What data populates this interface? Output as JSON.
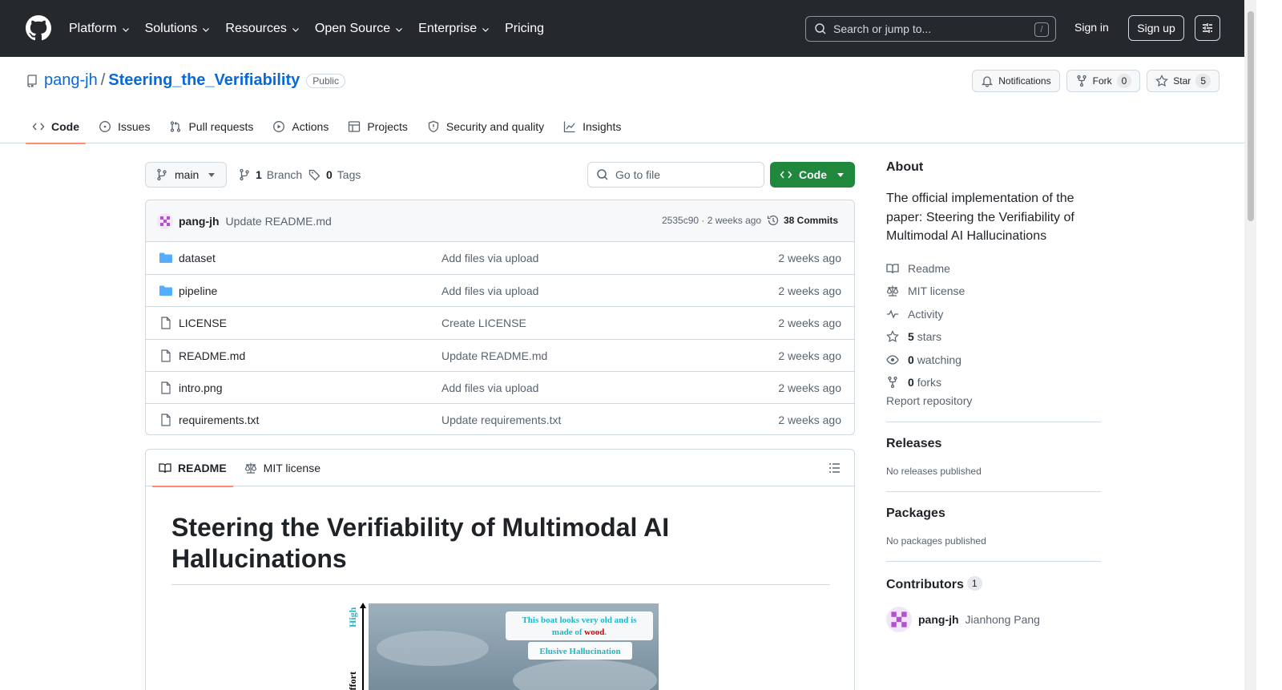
{
  "header": {
    "nav": [
      "Platform",
      "Solutions",
      "Resources",
      "Open Source",
      "Enterprise",
      "Pricing"
    ],
    "search_placeholder": "Search or jump to...",
    "search_shortcut": "/",
    "signin": "Sign in",
    "signup": "Sign up"
  },
  "repo": {
    "owner": "pang-jh",
    "separator": "/",
    "name": "Steering_the_Verifiability",
    "visibility": "Public",
    "notifications": "Notifications",
    "fork_label": "Fork",
    "fork_count": "0",
    "star_label": "Star",
    "star_count": "5"
  },
  "tabs": [
    "Code",
    "Issues",
    "Pull requests",
    "Actions",
    "Projects",
    "Security and quality",
    "Insights"
  ],
  "branchbar": {
    "branch": "main",
    "branch_count": "1",
    "branch_label": "Branch",
    "tag_count": "0",
    "tag_label": "Tags",
    "goto_placeholder": "Go to file",
    "code_button": "Code"
  },
  "commit": {
    "author": "pang-jh",
    "message": "Update README.md",
    "sha_time": "2535c90 · 2 weeks ago",
    "commits": "38 Commits"
  },
  "files": [
    {
      "name": "dataset",
      "type": "dir",
      "message": "Add files via upload",
      "time": "2 weeks ago"
    },
    {
      "name": "pipeline",
      "type": "dir",
      "message": "Add files via upload",
      "time": "2 weeks ago"
    },
    {
      "name": "LICENSE",
      "type": "file",
      "message": "Create LICENSE",
      "time": "2 weeks ago"
    },
    {
      "name": "README.md",
      "type": "file",
      "message": "Update README.md",
      "time": "2 weeks ago"
    },
    {
      "name": "intro.png",
      "type": "file",
      "message": "Add files via upload",
      "time": "2 weeks ago"
    },
    {
      "name": "requirements.txt",
      "type": "file",
      "message": "Update requirements.txt",
      "time": "2 weeks ago"
    }
  ],
  "readme": {
    "tab_readme": "README",
    "tab_license": "MIT license",
    "title": "Steering the Verifiability of Multimodal AI Hallucinations",
    "figure": {
      "axis_high": "High",
      "axis_label": "n Effort",
      "bubble_text_1": "This boat looks very old and is",
      "bubble_text_2a": "made of ",
      "bubble_text_2b": "wood",
      "bubble_text_2c": ".",
      "tag": "Elusive Hallucination"
    }
  },
  "about": {
    "heading": "About",
    "description": "The official implementation of the paper: Steering the Verifiability of Multimodal AI Hallucinations",
    "readme": "Readme",
    "license": "MIT license",
    "activity": "Activity",
    "stars_count": "5",
    "stars_label": "stars",
    "watching_count": "0",
    "watching_label": "watching",
    "forks_count": "0",
    "forks_label": "forks",
    "report": "Report repository"
  },
  "releases": {
    "heading": "Releases",
    "text": "No releases published"
  },
  "packages": {
    "heading": "Packages",
    "text": "No packages published"
  },
  "contributors": {
    "heading": "Contributors",
    "count": "1",
    "login": "pang-jh",
    "fullname": "Jianhong Pang"
  },
  "colors": {
    "accent": "#0969da",
    "header_bg": "#25292e",
    "green": "#1f883d",
    "tab_underline": "#fd8c73",
    "folder": "#54aeff"
  }
}
